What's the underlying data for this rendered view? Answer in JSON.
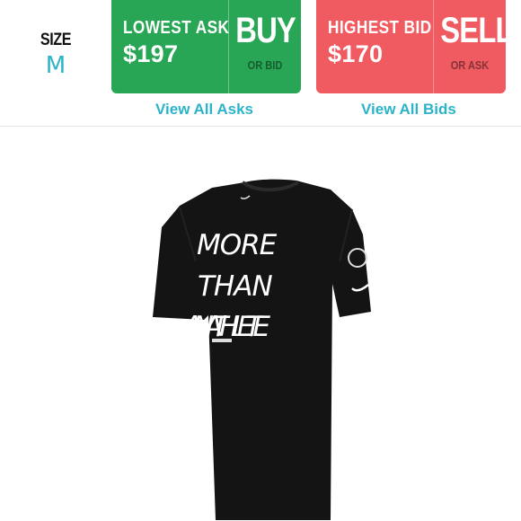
{
  "size": {
    "label": "SIZE",
    "value": "M"
  },
  "lowest_ask": {
    "title": "LOWEST ASK",
    "price": "$197",
    "action": "BUY",
    "sub": "OR BID",
    "color": "#28a655"
  },
  "highest_bid": {
    "title": "HIGHEST BID",
    "price": "$170",
    "action": "SELL",
    "sub": "OR ASK",
    "color": "#f05b62"
  },
  "links": {
    "view_asks": "View All Asks",
    "view_bids": "View All Bids"
  },
  "product": {
    "graphic_lines": [
      "MORE",
      "THAN",
      "AN ATHLETE"
    ],
    "icon": "tshirt-image"
  },
  "colors": {
    "accent": "#2bb3c9",
    "shirt": "#141414"
  }
}
